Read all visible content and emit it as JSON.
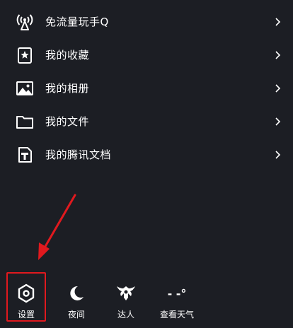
{
  "menu": {
    "items": [
      {
        "label": "免流量玩手Q",
        "icon": "signal-tower-icon"
      },
      {
        "label": "我的收藏",
        "icon": "bookmark-star-icon"
      },
      {
        "label": "我的相册",
        "icon": "photo-icon"
      },
      {
        "label": "我的文件",
        "icon": "folder-icon"
      },
      {
        "label": "我的腾讯文档",
        "icon": "tencent-docs-icon"
      }
    ]
  },
  "toolbar": {
    "settings_label": "设置",
    "night_label": "夜间",
    "expert_label": "达人",
    "weather_label": "查看天气",
    "weather_value": "- -°"
  },
  "colors": {
    "background": "#1c1e24",
    "annotation": "#e0191e"
  }
}
